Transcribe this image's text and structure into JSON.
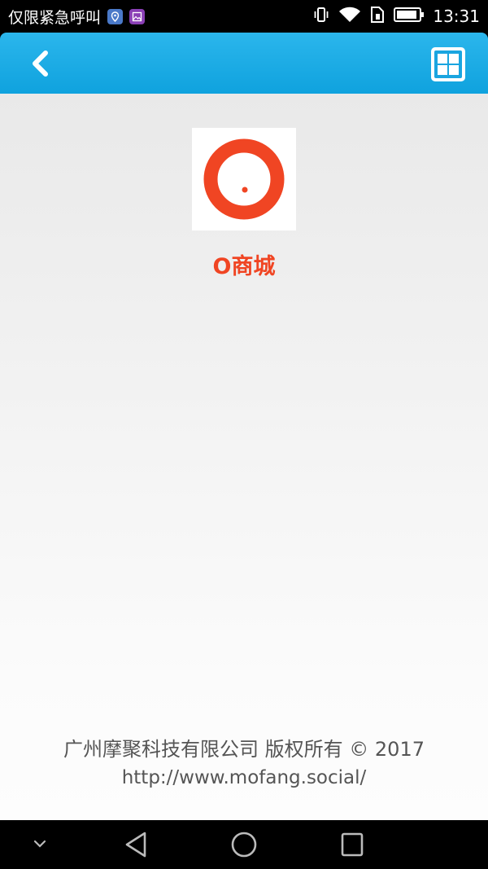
{
  "status_bar": {
    "carrier": "仅限紧急呼叫",
    "time": "13:31"
  },
  "icons": {
    "back": "chevron-left-icon",
    "grid": "grid-menu-icon",
    "app": "o-mall-logo-icon"
  },
  "app": {
    "name": "O商城"
  },
  "footer": {
    "copyright": "广州摩聚科技有限公司 版权所有 © 2017",
    "url": "http://www.mofang.social/"
  },
  "colors": {
    "header": "#1aaae3",
    "accent": "#f04523",
    "background": "#eeeeee"
  }
}
